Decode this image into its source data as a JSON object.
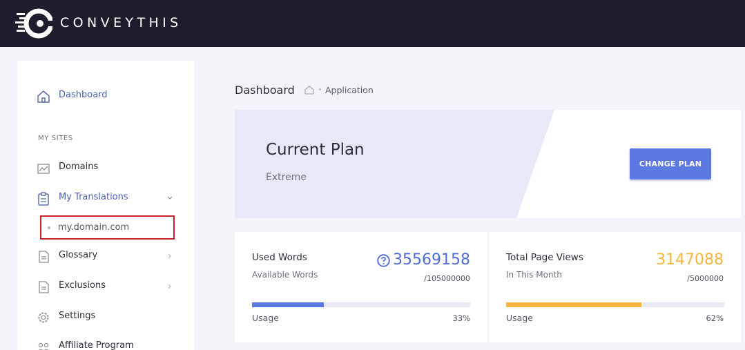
{
  "brand": {
    "name": "CONVEYTHIS"
  },
  "colors": {
    "accent": "#5b78e3",
    "warning": "#f4b63c",
    "topbar": "#1e1d2e",
    "highlight": "#c8222a"
  },
  "sidebar": {
    "dashboard": {
      "label": "Dashboard",
      "icon": "home-icon"
    },
    "section_label": "MY SITES",
    "items": [
      {
        "label": "Domains",
        "icon": "chart-icon"
      },
      {
        "label": "My Translations",
        "icon": "clipboard-icon"
      },
      {
        "label": "Glossary",
        "icon": "document-icon"
      },
      {
        "label": "Exclusions",
        "icon": "document-icon"
      },
      {
        "label": "Settings",
        "icon": "gear-icon"
      },
      {
        "label": "Affiliate Program",
        "icon": "users-icon"
      }
    ],
    "sub_item": {
      "label": "my.domain.com"
    }
  },
  "breadcrumb": {
    "title": "Dashboard",
    "current": "Application"
  },
  "plan": {
    "title": "Current Plan",
    "name": "Extreme",
    "button_label": "CHANGE PLAN"
  },
  "stats": [
    {
      "title": "Used Words",
      "subtitle": "Available Words",
      "value": "35569158",
      "limit": "/105000000",
      "usage_label": "Usage",
      "usage_pct": "33%",
      "usage_fraction": 0.33
    },
    {
      "title": "Total Page Views",
      "subtitle": "In This Month",
      "value": "3147088",
      "limit": "/5000000",
      "usage_label": "Usage",
      "usage_pct": "62%",
      "usage_fraction": 0.62
    }
  ]
}
